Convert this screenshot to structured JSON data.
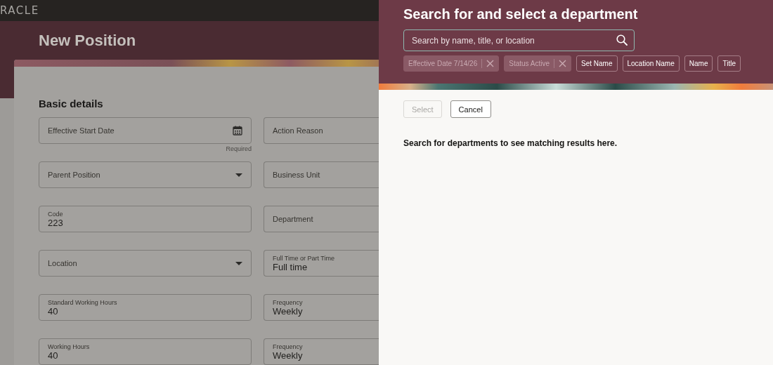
{
  "brand": {
    "logo": "RACLE"
  },
  "page": {
    "title": "New Position",
    "section": "Basic details",
    "fields": [
      {
        "kind": "date",
        "label": "Effective Start Date",
        "helper": "Required"
      },
      {
        "kind": "select",
        "label": "Parent Position"
      },
      {
        "kind": "text",
        "label": "Code",
        "value": "223"
      },
      {
        "kind": "select",
        "label": "Location"
      },
      {
        "kind": "text",
        "label": "Standard Working Hours",
        "value": "40"
      },
      {
        "kind": "text",
        "label": "Working Hours",
        "value": "40"
      },
      {
        "kind": "text",
        "label": "Action Reason"
      },
      {
        "kind": "text",
        "label": "Business Unit"
      },
      {
        "kind": "text",
        "label": "Department"
      },
      {
        "kind": "text",
        "label": "Full Time or Part Time",
        "value": "Full time"
      },
      {
        "kind": "text",
        "label": "Frequency",
        "value": "Weekly"
      },
      {
        "kind": "text",
        "label": "Frequency",
        "value": "Weekly"
      }
    ]
  },
  "drawer": {
    "title": "Search for and select a department",
    "search": {
      "placeholder": "Search by name, title, or location"
    },
    "filters": [
      {
        "label": "Effective Date 7/14/26",
        "disabled": true,
        "removable": true
      },
      {
        "label": "Status Active",
        "disabled": true,
        "removable": true
      },
      {
        "label": "Set Name",
        "disabled": false,
        "removable": false
      },
      {
        "label": "Location Name",
        "disabled": false,
        "removable": false
      },
      {
        "label": "Name",
        "disabled": false,
        "removable": false
      },
      {
        "label": "Title",
        "disabled": false,
        "removable": false
      }
    ],
    "buttons": [
      {
        "label": "Select",
        "disabled": true
      },
      {
        "label": "Cancel",
        "disabled": false
      }
    ],
    "message": "Search for departments to see matching results here."
  }
}
